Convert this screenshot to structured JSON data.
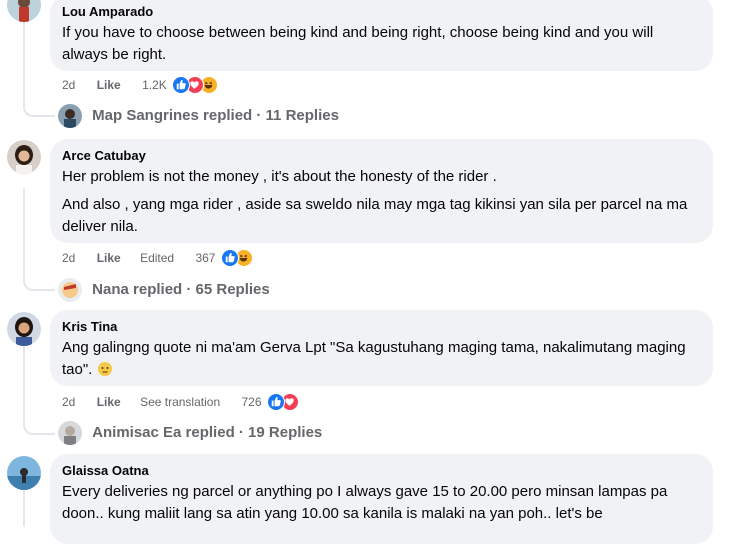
{
  "comments": [
    {
      "author": "Lou Amparado",
      "paragraphs": [
        "If you have to choose between being kind and being right, choose being kind and you will always be right."
      ],
      "time": "2d",
      "like_label": "Like",
      "extra": "",
      "reaction_count": "1.2K",
      "reactions": [
        "like-icon",
        "love-icon",
        "haha-icon"
      ],
      "replies_text": "Map Sangrines replied · 11 Replies"
    },
    {
      "author": "Arce Catubay",
      "paragraphs": [
        "Her problem is not the money , it's about the honesty of the rider .",
        "And also , yang mga rider , aside sa sweldo nila may mga tag kikinsi yan sila per parcel na ma deliver nila."
      ],
      "time": "2d",
      "like_label": "Like",
      "extra": "Edited",
      "reaction_count": "367",
      "reactions": [
        "like-icon",
        "haha-icon"
      ],
      "replies_text": "Nana replied · 65 Replies"
    },
    {
      "author": "Kris Tina",
      "paragraphs": [
        "Ang galingng quote ni ma'am Gerva Lpt \"Sa kagustuhang maging tama, nakalimutang maging tao\"."
      ],
      "time": "2d",
      "like_label": "Like",
      "extra": "See translation",
      "reaction_count": "726",
      "reactions": [
        "like-icon",
        "love-icon"
      ],
      "replies_text": "Animisac Ea replied · 19 Replies"
    },
    {
      "author": "Glaissa Oatna",
      "paragraphs": [
        "Every deliveries ng parcel or anything po I always gave 15 to 20.00 pero minsan lampas pa doon.. kung maliit lang sa atin yang 10.00 sa kanila is malaki na yan poh.. let's be"
      ]
    }
  ],
  "colors": {
    "bubble": "#f0f2f5",
    "meta": "#65676b",
    "like": "#1877f2",
    "love": "#f33e58",
    "haha": "#f7b125"
  }
}
